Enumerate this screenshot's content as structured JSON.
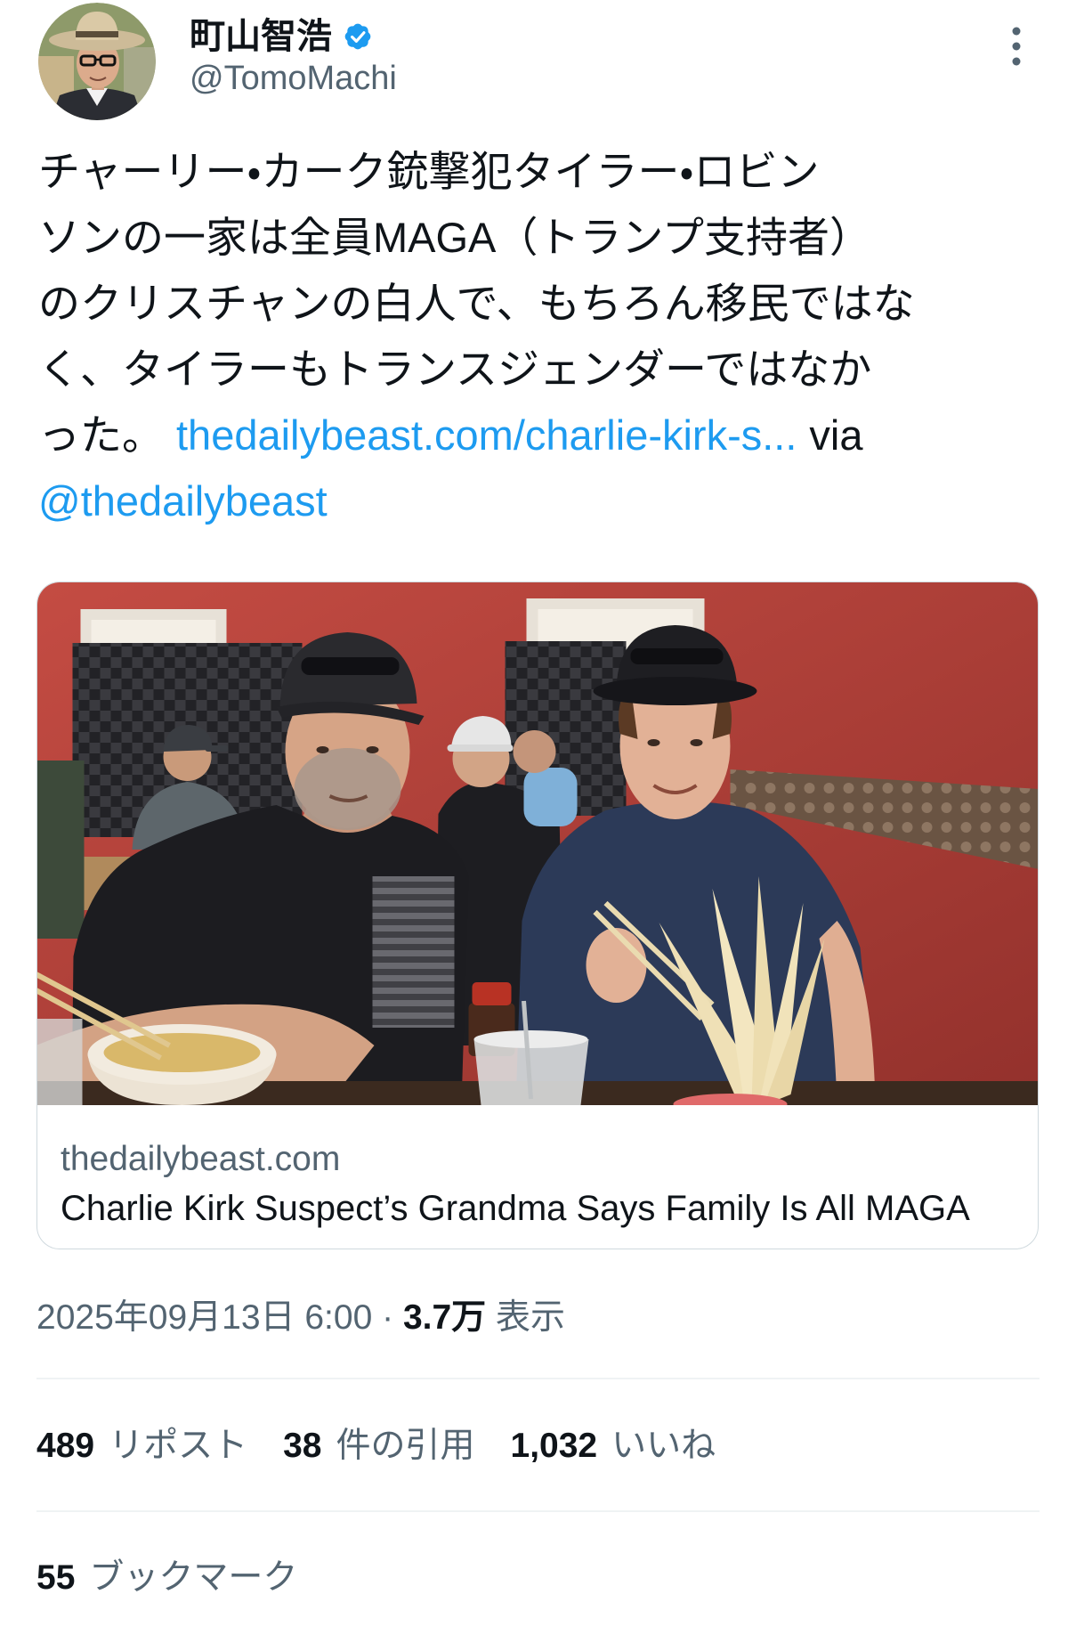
{
  "user": {
    "name": "町山智浩",
    "handle": "@TomoMachi",
    "verified": true
  },
  "tweet": {
    "lines": [
      "チャーリー・カーク銃撃犯タイラー・ロビン",
      "ソンの一家は全員MAGA（トランプ支持者）",
      "のクリスチャンの白人で、もちろん移民ではな",
      "く、タイラーもトランスジェンダーではなか"
    ],
    "line5": {
      "text": "った。",
      "link": "thedailybeast.com/charlie-kirk-s...",
      "via": "via"
    },
    "mention": "@thedailybeast"
  },
  "card": {
    "domain": "thedailybeast.com",
    "title": "Charlie Kirk Suspect’s Grandma Says Family Is All MAGA"
  },
  "meta": {
    "timestamp": "2025年09月13日 6:00",
    "separator": "·",
    "views_count": "3.7万",
    "views_label": "表示"
  },
  "stats": {
    "reposts_count": "489",
    "reposts_label": "リポスト",
    "quotes_count": "38",
    "quotes_label": "件の引用",
    "likes_count": "1,032",
    "likes_label": "いいね",
    "bookmarks_count": "55",
    "bookmarks_label": "ブックマーク"
  },
  "icons": {
    "verified": "verified-badge-icon",
    "more": "more-options-icon"
  },
  "colors": {
    "text_primary": "#0f1419",
    "text_secondary": "#536471",
    "link": "#1d9bf0",
    "border": "#cfd9de",
    "divider": "#eff3f4"
  }
}
